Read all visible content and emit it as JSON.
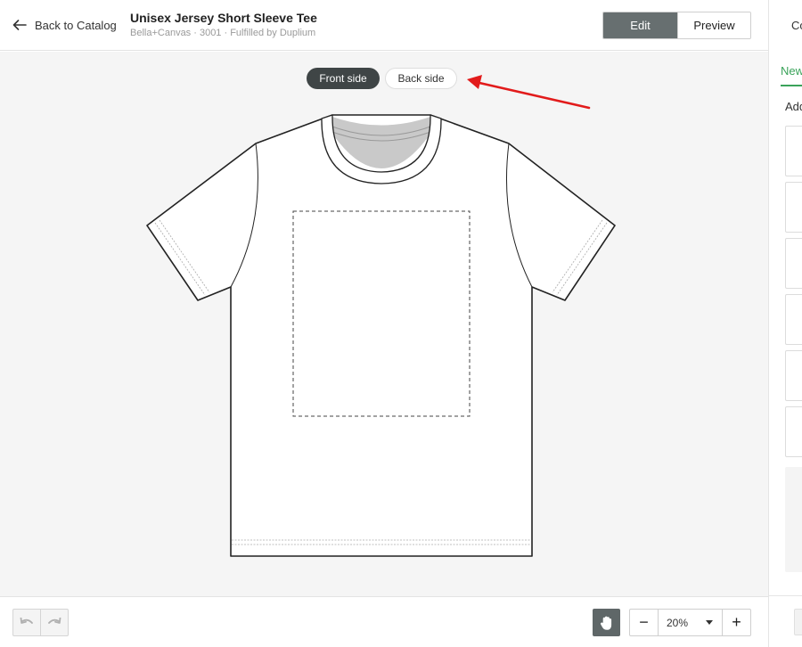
{
  "header": {
    "back_label": "Back to Catalog",
    "title": "Unisex Jersey Short Sleeve Tee",
    "subtitle": "Bella+Canvas · 3001 · Fulfilled by Duplium",
    "edit_label": "Edit",
    "preview_label": "Preview"
  },
  "canvas": {
    "sides": [
      {
        "label": "Front side",
        "selected": true
      },
      {
        "label": "Back side",
        "selected": false
      }
    ]
  },
  "panel": {
    "header": "Co",
    "tab": "New",
    "add_label": "Add"
  },
  "footer": {
    "zoom_value": "20%",
    "zoom_out_symbol": "−",
    "zoom_in_symbol": "+"
  },
  "icons": {
    "back": "arrow-left-icon",
    "undo": "undo-icon",
    "redo": "redo-icon",
    "pan": "hand-icon",
    "zoom_dropdown": "chevron-down-icon"
  },
  "colors": {
    "accent_green": "#3aa35a",
    "edit_active": "#676f70",
    "side_active": "#3f4546",
    "annotation_arrow": "#e21b1b",
    "canvas_bg": "#f5f5f5"
  }
}
